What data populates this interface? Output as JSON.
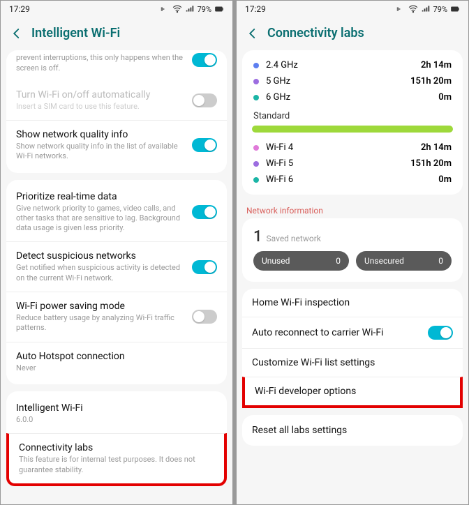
{
  "status": {
    "time": "17:29",
    "battery": "79%"
  },
  "left": {
    "title": "Intelligent Wi-Fi",
    "partial_desc": "prevent interruptions, this only happens when the screen is off.",
    "items": [
      {
        "title": "Turn Wi-Fi on/off automatically",
        "sub": "Insert a SIM card to use this feature.",
        "toggle": "off",
        "disabled": true
      },
      {
        "title": "Show network quality info",
        "sub": "Show network quality info in the list of available Wi-Fi networks.",
        "toggle": "on"
      }
    ],
    "items2": [
      {
        "title": "Prioritize real-time data",
        "sub": "Give network priority to games, video calls, and other tasks that are sensitive to lag. Background data usage is given less priority.",
        "toggle": "on"
      },
      {
        "title": "Detect suspicious networks",
        "sub": "Get notified when suspicious activity is detected on the current Wi-Fi network.",
        "toggle": "on"
      },
      {
        "title": "Wi-Fi power saving mode",
        "sub": "Reduce battery usage by analyzing Wi-Fi traffic patterns.",
        "toggle": "off"
      },
      {
        "title": "Auto Hotspot connection",
        "sub": "Never"
      }
    ],
    "items3": [
      {
        "title": "Intelligent Wi-Fi",
        "sub": "6.0.0"
      },
      {
        "title": "Connectivity labs",
        "sub": "This feature is for internal test purposes. It does not guarantee stability.",
        "highlight": true
      }
    ]
  },
  "right": {
    "title": "Connectivity labs",
    "bands": [
      {
        "label": "2.4 GHz",
        "val": "2h 14m",
        "color": "blue"
      },
      {
        "label": "5 GHz",
        "val": "151h 20m",
        "color": "purple"
      },
      {
        "label": "6 GHz",
        "val": "0m",
        "color": "teal"
      }
    ],
    "standard_label": "Standard",
    "wifis": [
      {
        "label": "Wi-Fi 4",
        "val": "2h 14m",
        "color": "pink"
      },
      {
        "label": "Wi-Fi 5",
        "val": "151h 20m",
        "color": "purple"
      },
      {
        "label": "Wi-Fi 6",
        "val": "0m",
        "color": "teal"
      }
    ],
    "net_info": "Network information",
    "saved_count": "1",
    "saved_label": "Saved network",
    "pills": [
      {
        "label": "Unused",
        "count": "0"
      },
      {
        "label": "Unsecured",
        "count": "0"
      }
    ],
    "rows": [
      {
        "title": "Home Wi-Fi inspection"
      },
      {
        "title": "Auto reconnect to carrier Wi-Fi",
        "toggle": "on"
      },
      {
        "title": "Customize Wi-Fi list settings"
      },
      {
        "title": "Wi-Fi developer options",
        "highlight": true
      }
    ],
    "reset": "Reset all labs settings"
  }
}
